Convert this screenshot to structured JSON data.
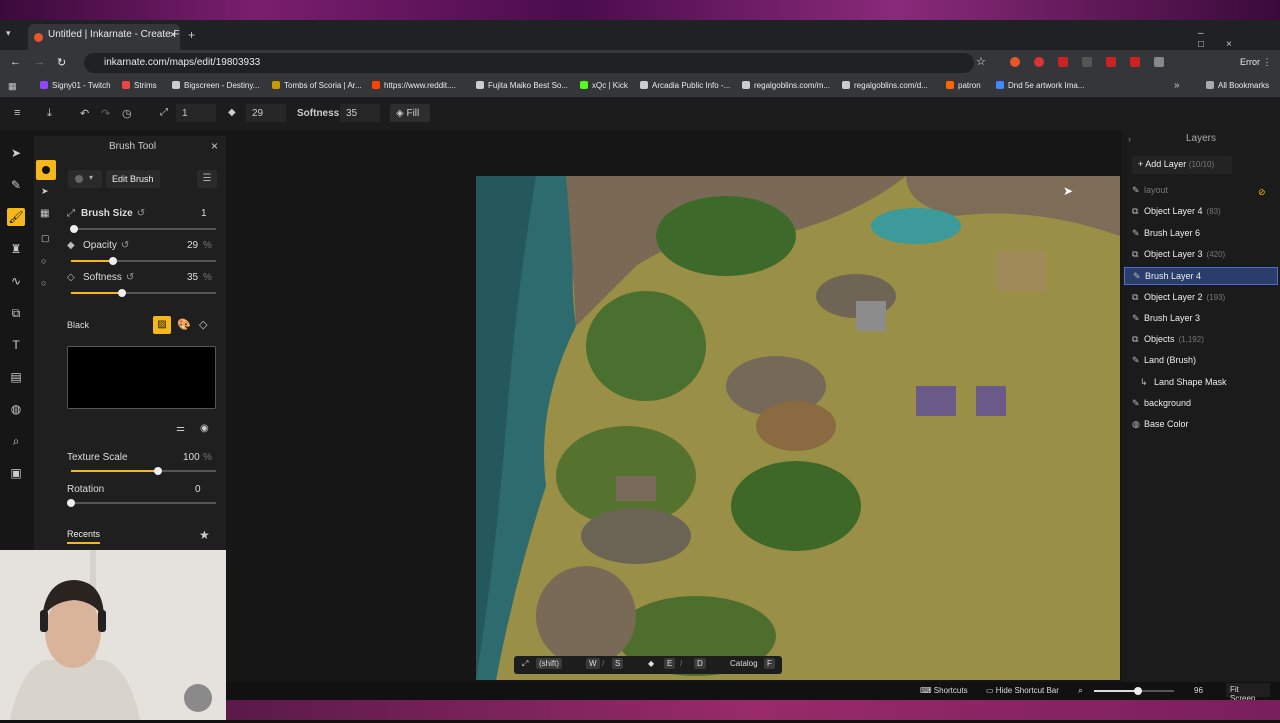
{
  "browser": {
    "tab_title": "Untitled | Inkarnate - Create Fa",
    "url": "inkarnate.com/maps/edit/19803933",
    "error_label": "Error",
    "bookmarks": [
      "Signy01 - Twitch",
      "Strims",
      "Bigscreen - Destiny...",
      "Tombs of Scoria | Ar...",
      "https://www.reddit....",
      "Fujita Maiko Best So...",
      "xQc | Kick",
      "Arcadia Public Info -...",
      "regalgoblins.com/m...",
      "regalgoblins.com/d...",
      "patron",
      "Dnd 5e artwork Ima..."
    ],
    "all_bookmarks": "All Bookmarks"
  },
  "toolbar": {
    "brush_size": "1",
    "opacity": "29",
    "softness_label": "Softness:",
    "softness": "35",
    "fill_label": "Fill"
  },
  "brush_panel": {
    "title": "Brush Tool",
    "edit_brush": "Edit Brush",
    "sliders": [
      {
        "label": "Brush Size",
        "value": "1",
        "level": 0.02
      },
      {
        "label": "Opacity",
        "value": "29",
        "unit": "%",
        "level": 0.29
      },
      {
        "label": "Softness",
        "value": "35",
        "unit": "%",
        "level": 0.35
      }
    ],
    "color_name": "Black",
    "swatch_color": "#000000",
    "texture_scale_label": "Texture Scale",
    "texture_scale": "100",
    "texture_unit": "%",
    "texture_level": 0.6,
    "rotation_label": "Rotation",
    "rotation": "0",
    "rotation_level": 0.0,
    "recents": "Recents"
  },
  "layers_panel": {
    "title": "Layers",
    "add_layer": "Add Layer",
    "add_count": "(10/10)",
    "items": [
      {
        "name": "layout",
        "count": "",
        "icon": "pencil-icon",
        "dim": true
      },
      {
        "name": "Object Layer 4",
        "count": "(83)",
        "icon": "stack-icon"
      },
      {
        "name": "Brush Layer 6",
        "count": "",
        "icon": "brush-icon"
      },
      {
        "name": "Object Layer 3",
        "count": "(420)",
        "icon": "stack-icon"
      },
      {
        "name": "Brush Layer 4",
        "count": "",
        "icon": "brush-icon",
        "selected": true
      },
      {
        "name": "Object Layer 2",
        "count": "(193)",
        "icon": "stack-icon"
      },
      {
        "name": "Brush Layer 3",
        "count": "",
        "icon": "brush-icon"
      },
      {
        "name": "Objects",
        "count": "(1,192)",
        "icon": "stack-icon"
      },
      {
        "name": "Land (Brush)",
        "count": "",
        "icon": "brush-icon"
      },
      {
        "name": "Land Shape Mask",
        "count": "",
        "icon": "mask-icon"
      },
      {
        "name": "background",
        "count": "",
        "icon": "brush-icon"
      },
      {
        "name": "Base Color",
        "count": "",
        "icon": "globe-icon"
      }
    ]
  },
  "shortcut_bar": {
    "shift": "(shift)",
    "keys": [
      "W",
      "S",
      "E",
      "D"
    ],
    "catalog": "Catalog",
    "catalog_key": "F"
  },
  "status": {
    "shortcuts": "Shortcuts",
    "hide_shortcut_bar": "Hide Shortcut Bar",
    "zoom": "96",
    "zoom_level": 0.55,
    "fit_screen": "Fit Screen"
  },
  "colors": {
    "accent": "#f4b81c",
    "selected_layer": "#2a3d6b"
  }
}
